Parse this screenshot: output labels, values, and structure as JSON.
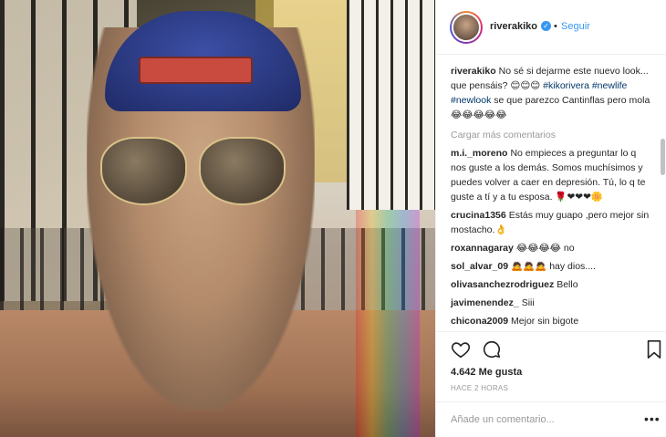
{
  "post": {
    "username": "riverakiko",
    "dot": "•",
    "follow_label": "Seguir"
  },
  "caption": {
    "user": "riverakiko",
    "text_1": "No sé si dejarme este nuevo look... que pensáis? 😊😊😊 ",
    "hashtag_1": "#kikorivera",
    "hashtag_2": "#newlife",
    "hashtag_3": "#newlook",
    "text_2": " se que parezco Cantinflas pero mola 😂😂😂😂😂"
  },
  "load_more": "Cargar más comentarios",
  "comments": [
    {
      "user": "m.i._moreno",
      "text": "No empieces a preguntar lo q nos guste a los demás. Somos muchísimos y puedes volver a caer en depresión. Tú, lo q te guste a tí y a tu esposa. 🌹❤❤❤🌼"
    },
    {
      "user": "crucina1356",
      "text": "Estás muy guapo ,pero mejor sin mostacho.👌"
    },
    {
      "user": "roxannagaray",
      "text": "😂😂😂😂 no"
    },
    {
      "user": "sol_alvar_09",
      "text": "🙇🙇🙇 hay dios...."
    },
    {
      "user": "olivasanchezrodriguez",
      "text": "Bello"
    },
    {
      "user": "javimenendez_",
      "text": "Siii"
    },
    {
      "user": "chicona2009",
      "text": "Mejor sin bigote"
    }
  ],
  "likes": "4.642 Me gusta",
  "time": "HACE 2 HORAS",
  "add_comment_placeholder": "Añade un comentario...",
  "options_glyph": "•••",
  "verified_glyph": "✓",
  "icons": {
    "like": "heart-icon",
    "comment": "speech-bubble-icon",
    "save": "bookmark-icon"
  }
}
